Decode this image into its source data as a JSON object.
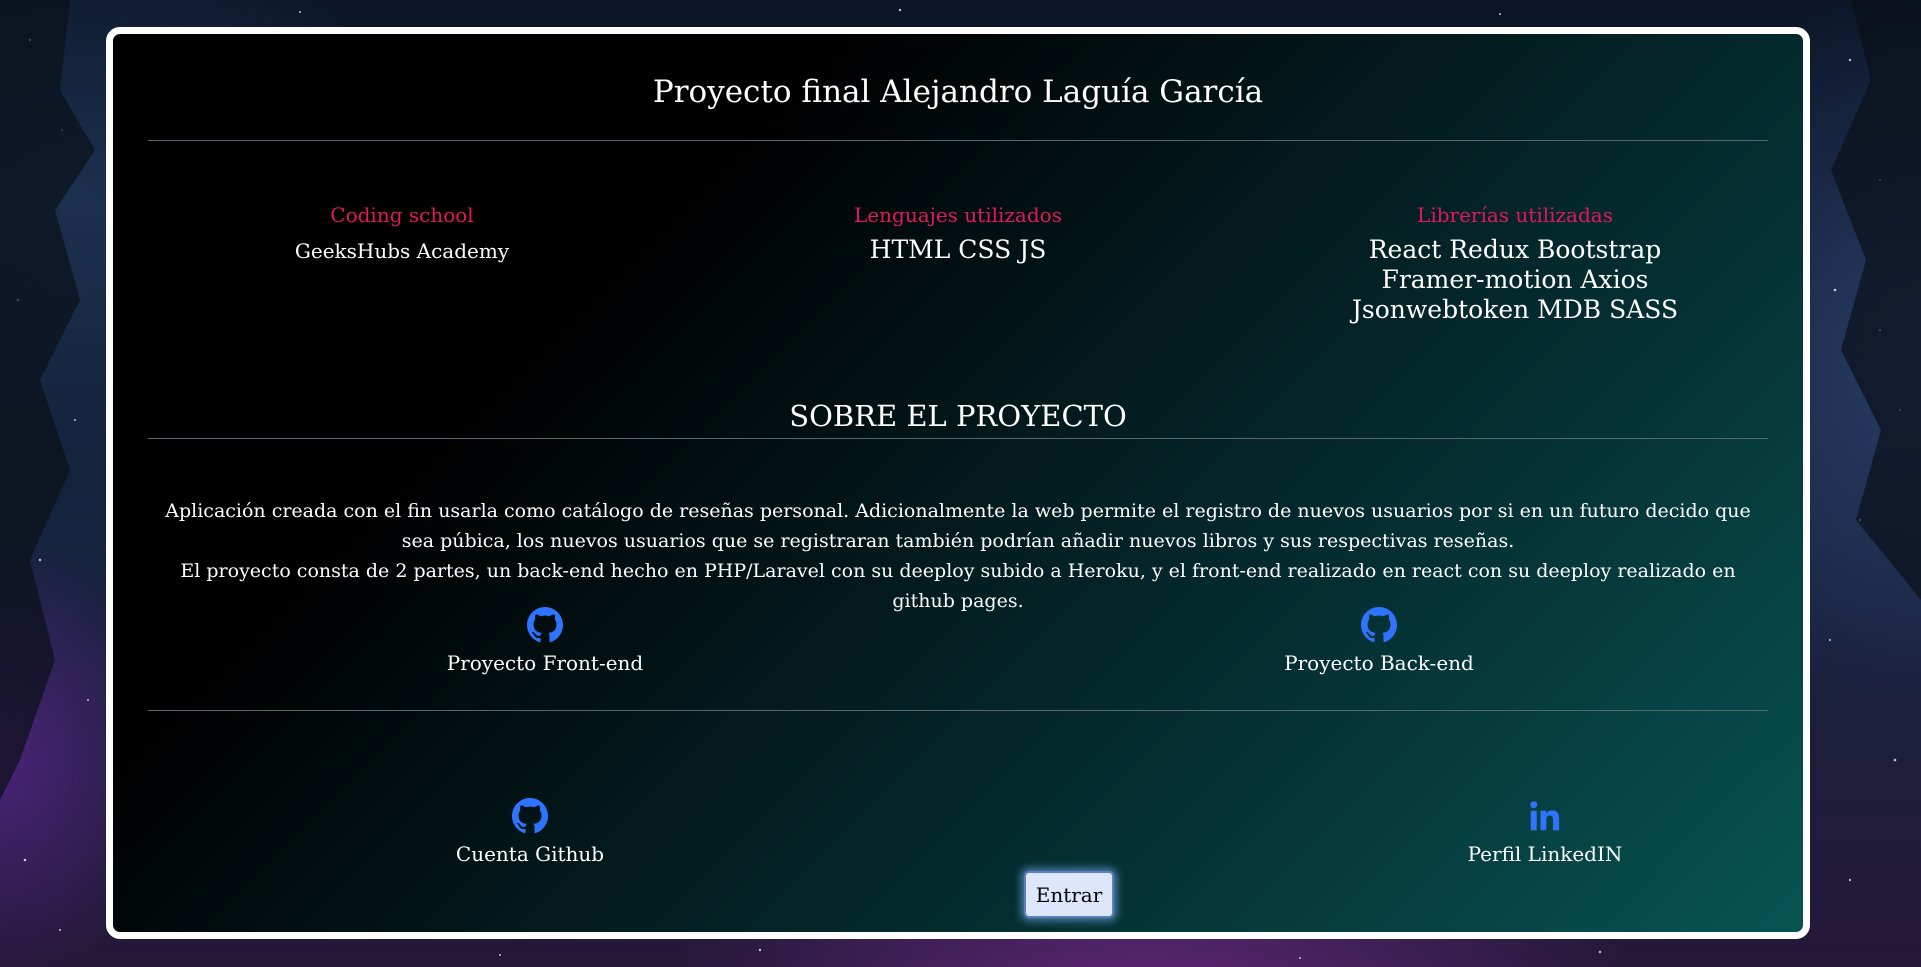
{
  "page": {
    "title": "Proyecto final Alejandro Laguía García"
  },
  "info_columns": [
    {
      "heading": "Coding school",
      "body": "GeeksHubs Academy"
    },
    {
      "heading": "Lenguajes utilizados",
      "body": "HTML CSS JS"
    },
    {
      "heading": "Librerías utilizadas",
      "body": "React Redux Bootstrap Framer-motion Axios Jsonwebtoken MDB SASS"
    }
  ],
  "about": {
    "title": "SOBRE EL PROYECTO",
    "paragraph1": "Aplicación creada con el fin usarla como catálogo de reseñas personal. Adicionalmente la web permite el registro de nuevos usuarios por si en un futuro decido que sea púbica, los nuevos usuarios que se registraran también podrían añadir nuevos libros y sus respectivas reseñas.",
    "paragraph2": "El proyecto consta de 2 partes, un back-end hecho en PHP/Laravel con su deeploy subido a Heroku, y el front-end realizado en react con su deeploy realizado en github pages."
  },
  "project_links": {
    "front": {
      "label": "Proyecto Front-end",
      "icon": "github-icon"
    },
    "back": {
      "label": "Proyecto Back-end",
      "icon": "github-icon"
    }
  },
  "profile_links": {
    "github": {
      "label": "Cuenta Github",
      "icon": "github-icon"
    },
    "linkedin": {
      "label": "Perfil LinkedIN",
      "icon": "linkedin-icon"
    }
  },
  "enter_button": {
    "label": "Entrar"
  },
  "colors": {
    "accent_heading": "#e3175a",
    "icon_blue": "#2f74ff",
    "card_border": "#ffffff",
    "button_bg": "#dde6fb"
  }
}
